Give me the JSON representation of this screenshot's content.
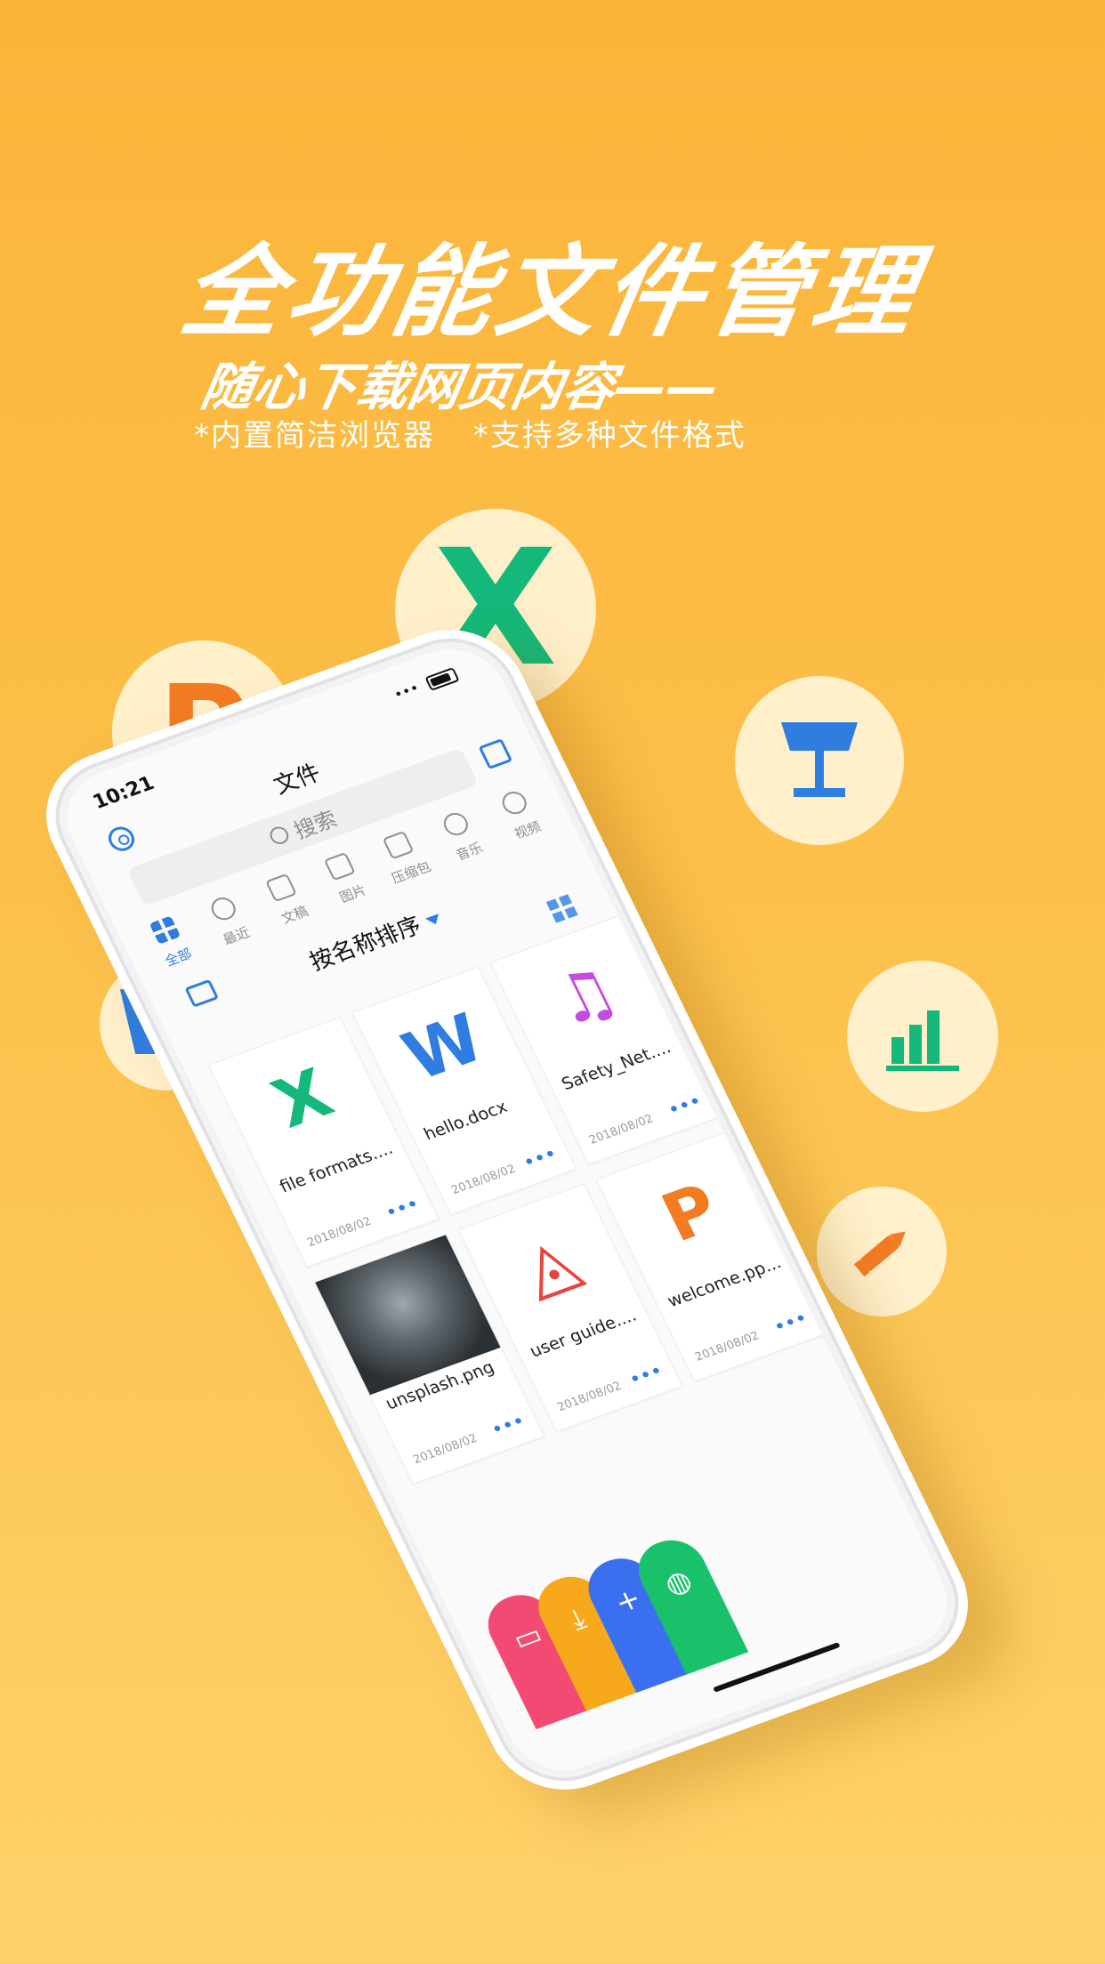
{
  "promo": {
    "headline": "全功能文件管理",
    "subheadline": "随心下载网页内容——",
    "features": [
      "*内置简洁浏览器",
      "*支持多种文件格式"
    ]
  },
  "floating_icons": [
    {
      "name": "excel-icon",
      "glyph": "X",
      "color": "#14b87a"
    },
    {
      "name": "powerpoint-icon",
      "glyph": "P",
      "color": "#f37b22"
    },
    {
      "name": "keynote-icon",
      "glyph": "keynote",
      "color": "#2f7de1"
    },
    {
      "name": "word-icon",
      "glyph": "W",
      "color": "#2f7de1"
    },
    {
      "name": "numbers-icon",
      "glyph": "bars",
      "color": "#14b87a"
    },
    {
      "name": "music-icon",
      "glyph": "♫",
      "color": "#c44be0"
    },
    {
      "name": "pen-icon",
      "glyph": "pen",
      "color": "#f37b22"
    }
  ],
  "phone": {
    "status": {
      "time": "10:21",
      "signal": "•••"
    },
    "title": "文件",
    "search_placeholder": "搜索",
    "categories": [
      {
        "label": "全部",
        "active": true
      },
      {
        "label": "最近"
      },
      {
        "label": "文稿"
      },
      {
        "label": "图片"
      },
      {
        "label": "压缩包"
      },
      {
        "label": "音乐"
      },
      {
        "label": "视频"
      }
    ],
    "sort_label": "按名称排序",
    "files": [
      {
        "name": "file formats....",
        "date": "2018/08/02",
        "glyph": "X",
        "color": "#14b87a"
      },
      {
        "name": "hello.docx",
        "date": "2018/08/02",
        "glyph": "W",
        "color": "#2f7de1"
      },
      {
        "name": "Safety_Net....",
        "date": "2018/08/02",
        "glyph": "♫",
        "color": "#c44be0"
      },
      {
        "name": "unsplash.png",
        "date": "2018/08/02",
        "glyph": "",
        "color": "#555555"
      },
      {
        "name": "user guide....",
        "date": "2018/08/02",
        "glyph": "◬",
        "color": "#e8453c"
      },
      {
        "name": "welcome.pp...",
        "date": "2018/08/02",
        "glyph": "P",
        "color": "#f37b22"
      }
    ],
    "more_label": "•••",
    "tabs": [
      {
        "name": "files-tab",
        "glyph": "▭",
        "color": "#f24a73"
      },
      {
        "name": "downloads-tab",
        "glyph": "⤓",
        "color": "#f7a81b"
      },
      {
        "name": "add-tab",
        "glyph": "+",
        "color": "#3a6ff0"
      },
      {
        "name": "browser-tab",
        "glyph": "◍",
        "color": "#19c16b"
      }
    ]
  }
}
